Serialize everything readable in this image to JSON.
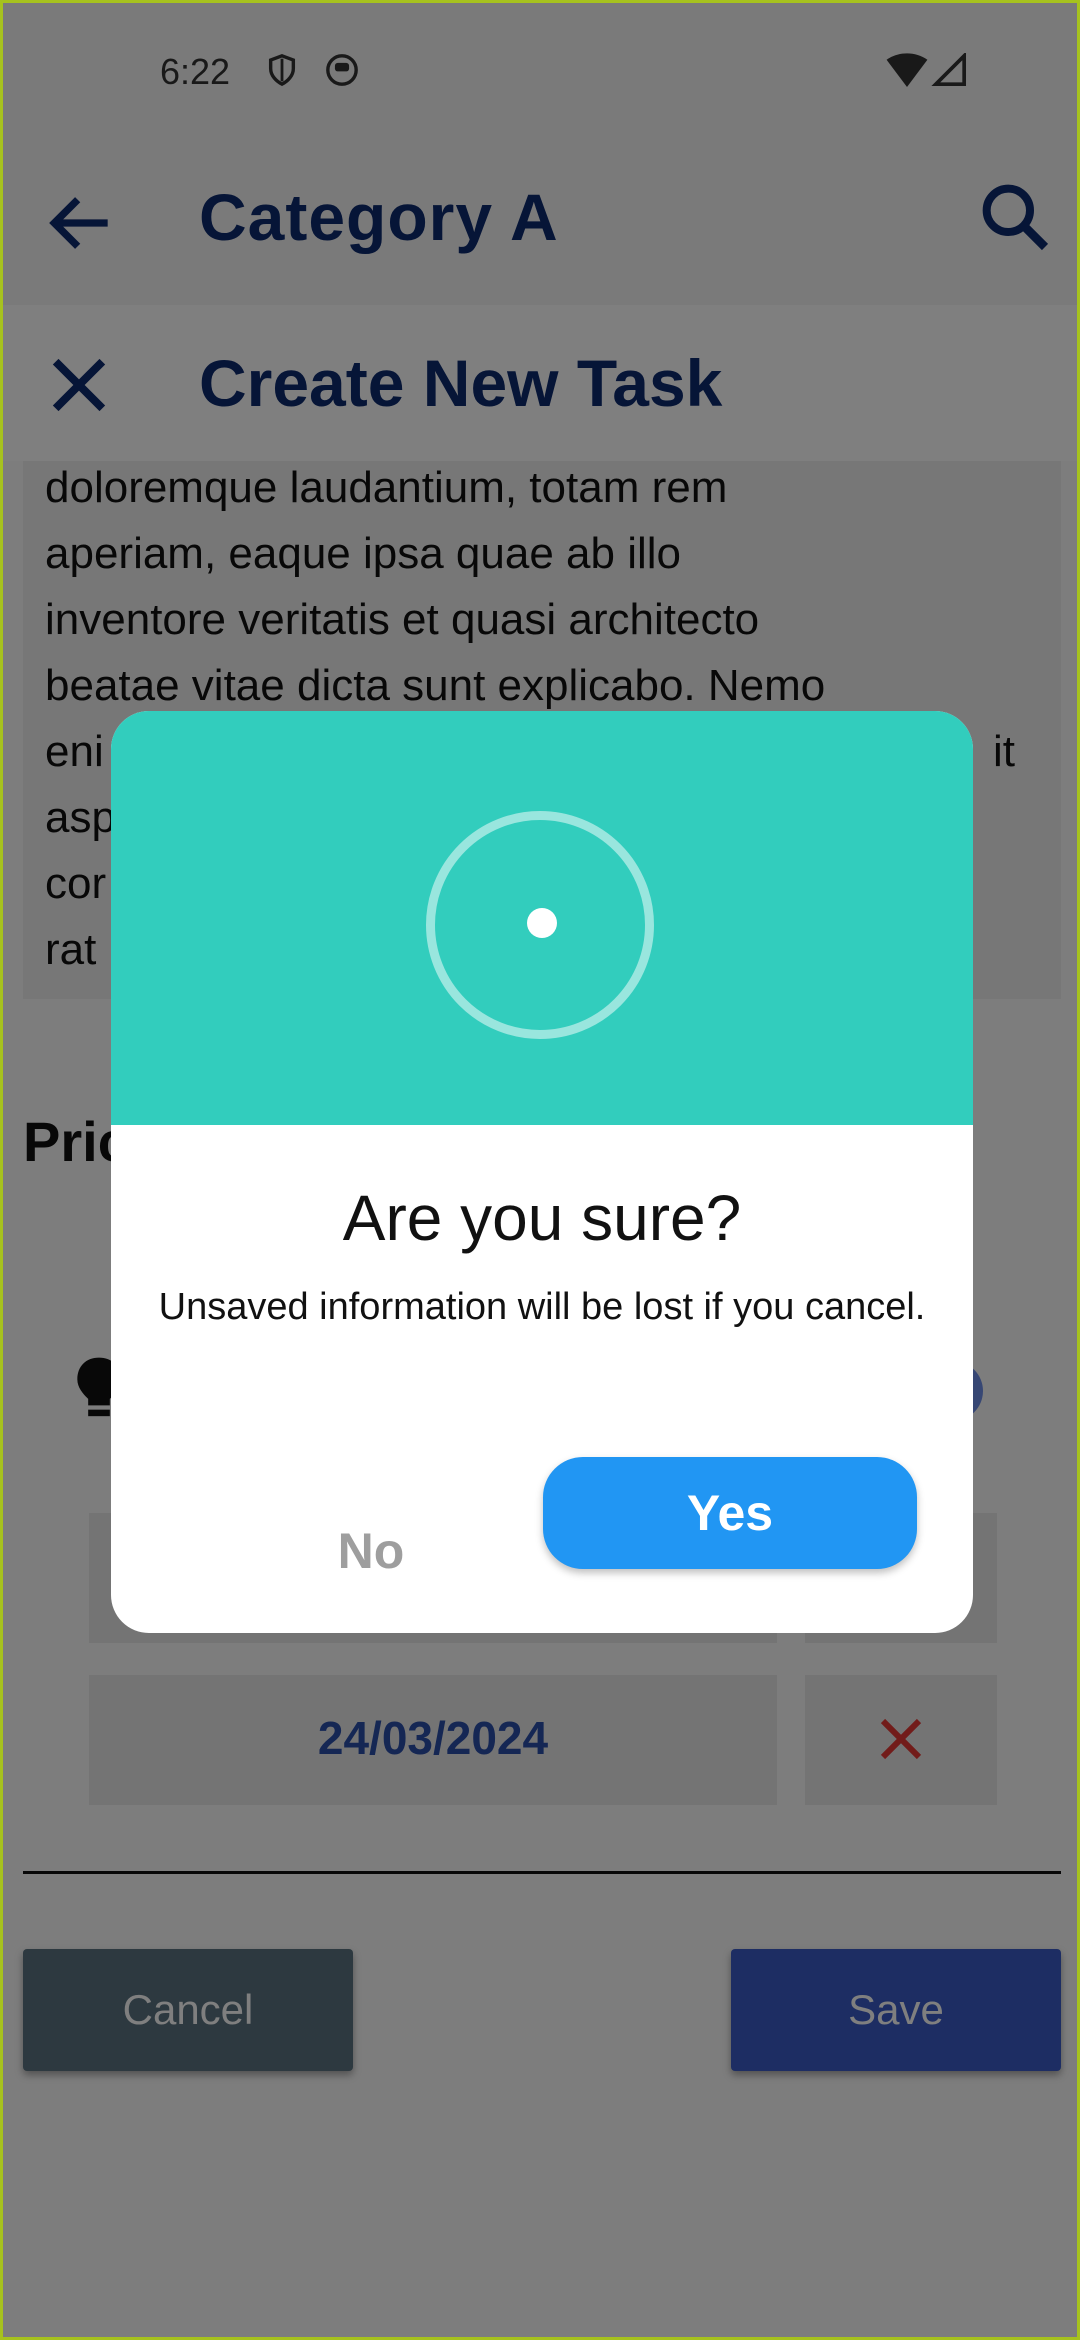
{
  "status_bar": {
    "time": "6:22",
    "icons": [
      "shield-icon",
      "app-notification-icon",
      "wifi-icon",
      "signal-icon"
    ]
  },
  "app_bar": {
    "title": "Category A",
    "back_icon": "arrow-back-icon",
    "search_icon": "search-icon"
  },
  "sheet": {
    "title": "Create New Task",
    "close_icon": "close-icon",
    "description_lines": [
      "doloremque laudantium, totam rem",
      "aperiam, eaque ipsa quae ab illo",
      "inventore veritatis et quasi architecto",
      "beatae vitae dicta sunt explicabo. Nemo",
      "eni",
      "asp",
      "cor",
      "rat"
    ],
    "description_line5_tail": "it",
    "priority_label": "Pric",
    "dates": [
      {
        "value": "",
        "remove_icon": "close-icon"
      },
      {
        "value": "24/03/2024",
        "remove_icon": "close-icon"
      }
    ],
    "cancel_label": "Cancel",
    "save_label": "Save"
  },
  "dialog": {
    "icon": "info-ring-icon",
    "title": "Are you sure?",
    "message": "Unsaved information will be lost if you cancel.",
    "no_label": "No",
    "yes_label": "Yes"
  },
  "colors": {
    "primary_dark": "#0d2a6e",
    "dialog_header": "#32cdbd",
    "yes_button": "#2196f3",
    "frame_border": "#a6c21e",
    "remove_x": "#e53935"
  }
}
